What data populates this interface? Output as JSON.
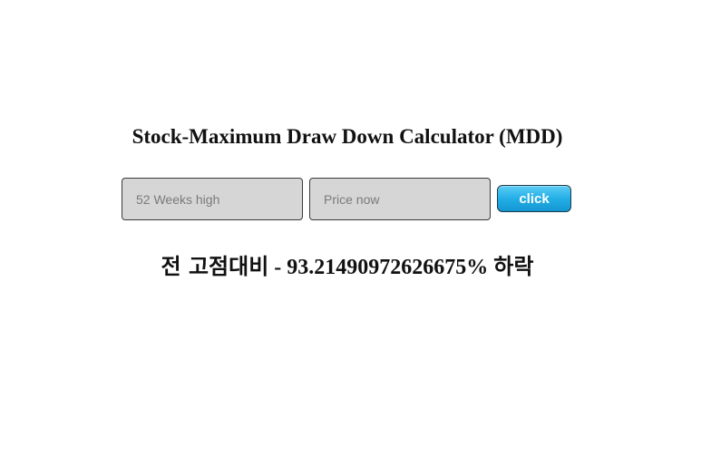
{
  "title": "Stock-Maximum Draw Down Calculator (MDD)",
  "inputs": {
    "high_placeholder": "52 Weeks high",
    "high_value": "",
    "price_placeholder": "Price now",
    "price_value": ""
  },
  "button": {
    "label": "click"
  },
  "result": {
    "prefix": "전 고점대비",
    "value": " - 93.21490972626675% ",
    "suffix": "하락"
  },
  "colors": {
    "button_top": "#5ccdf5",
    "button_bottom": "#1397d2",
    "input_bg": "#d6d6d6"
  }
}
